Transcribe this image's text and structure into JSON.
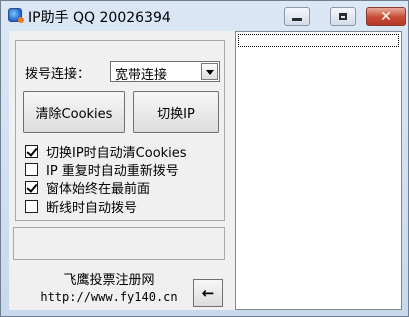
{
  "window": {
    "title": "IP助手 QQ 20026394",
    "accent_color": "#c74a34"
  },
  "controls": {
    "dial_label": "拨号连接：",
    "dial_select": {
      "value": "宽带连接"
    },
    "clear_cookies_label": "清除Cookies",
    "switch_ip_label": "切换IP",
    "checkboxes": [
      {
        "label": "切换IP时自动清Cookies",
        "checked": true
      },
      {
        "label": "IP 重复时自动重新拨号",
        "checked": false
      },
      {
        "label": "窗体始终在最前面",
        "checked": true
      },
      {
        "label": "断线时自动拨号",
        "checked": false
      }
    ],
    "status_text": ""
  },
  "footer": {
    "site_name": "飞鹰投票注册网",
    "site_url": "http://www.fy140.cn",
    "back_label": "←"
  },
  "log": {
    "items": []
  }
}
